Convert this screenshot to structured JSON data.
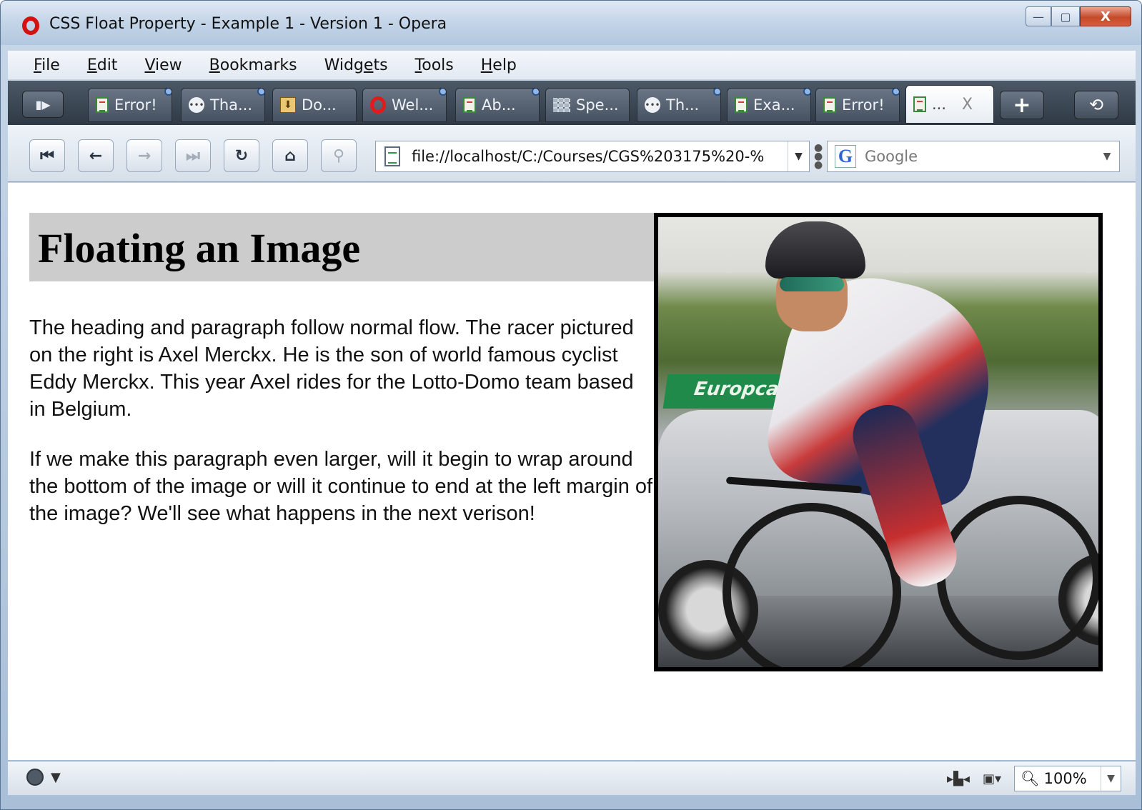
{
  "window": {
    "title": "CSS Float Property - Example 1 - Version 1 - Opera",
    "minimize": "—",
    "maximize": "▢",
    "close": "X"
  },
  "menu": [
    {
      "pre": "",
      "ul": "F",
      "post": "ile"
    },
    {
      "pre": "",
      "ul": "E",
      "post": "dit"
    },
    {
      "pre": "",
      "ul": "V",
      "post": "iew"
    },
    {
      "pre": "",
      "ul": "B",
      "post": "ookmarks"
    },
    {
      "pre": "Widg",
      "ul": "e",
      "post": "ts"
    },
    {
      "pre": "",
      "ul": "T",
      "post": "ools"
    },
    {
      "pre": "",
      "ul": "H",
      "post": "elp"
    }
  ],
  "tabs": [
    {
      "label": "Error!",
      "icon": "page-icon"
    },
    {
      "label": "Tha...",
      "icon": "chat-icon"
    },
    {
      "label": "Do...",
      "icon": "download-icon"
    },
    {
      "label": "Wel...",
      "icon": "opera-icon"
    },
    {
      "label": "Ab...",
      "icon": "page-icon"
    },
    {
      "label": "Spe...",
      "icon": "speed-dial-icon"
    },
    {
      "label": "Th...",
      "icon": "chat-icon"
    },
    {
      "label": "Exa...",
      "icon": "page-icon"
    },
    {
      "label": "Error!",
      "icon": "page-icon"
    },
    {
      "label": "...",
      "icon": "page-icon",
      "active": true
    }
  ],
  "tab_close": "X",
  "tab_overflow": "• • •",
  "nav": {
    "url": "file://localhost/C:/Courses/CGS%203175%20-%",
    "search_placeholder": "Google",
    "search_logo": "G"
  },
  "page": {
    "heading": "Floating an Image",
    "paragraph1": "The heading and paragraph follow normal flow. The racer pictured on the right is Axel Merckx. He is the son of world famous cyclist Eddy Merckx. This year Axel rides for the Lotto-Domo team based in Belgium.",
    "paragraph2": "If we make this paragraph even larger, will it begin to wrap around the bottom of the image or will it continue to end at the left margin of the image? We'll see what happens in the next verison!",
    "image_banner": "Europcar"
  },
  "status": {
    "zoom": "100%"
  }
}
